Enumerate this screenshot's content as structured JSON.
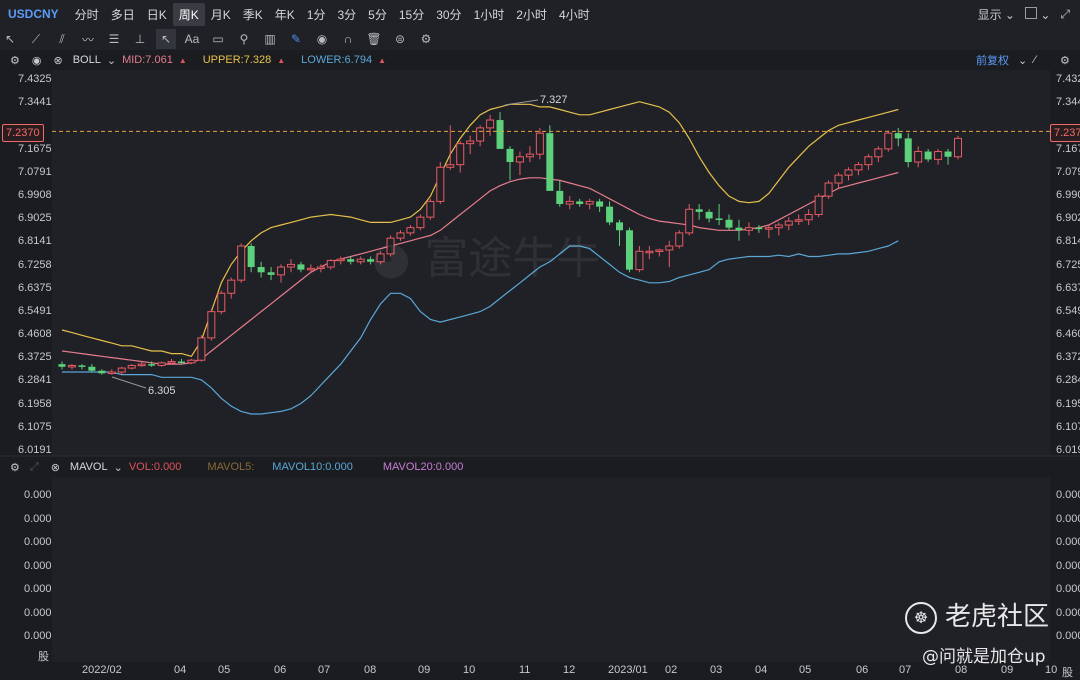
{
  "header": {
    "symbol": "USDCNY",
    "periods": [
      "分时",
      "多日",
      "日K",
      "周K",
      "月K",
      "季K",
      "年K",
      "1分",
      "3分",
      "5分",
      "15分",
      "30分",
      "1小时",
      "2小时",
      "4小时"
    ],
    "active_period": "周K",
    "display_label": "显示",
    "adjust_label": "前复权"
  },
  "toolbar": {
    "icons": [
      "cursor-icon",
      "line-icon",
      "channel-icon",
      "wave-icon",
      "fib-icon",
      "pitchfork-icon",
      "arrow-icon",
      "text-icon",
      "note-icon",
      "search-icon",
      "measure-icon",
      "pen-icon",
      "eye-icon",
      "magnet-icon",
      "trash-icon",
      "layers-icon",
      "gear-icon"
    ],
    "text_tool_label": "Aa"
  },
  "boll": {
    "name": "BOLL",
    "mid": "MID:7.061",
    "upper": "UPPER:7.328",
    "lower": "LOWER:6.794",
    "mid_color": "#e77c8e",
    "upper_color": "#e6c14a",
    "lower_color": "#5aa7d8"
  },
  "price_axis": {
    "ticks": [
      "7.4325",
      "7.3441",
      "7.2370",
      "7.1675",
      "7.0791",
      "6.9908",
      "6.9025",
      "6.8141",
      "6.7258",
      "6.6375",
      "6.5491",
      "6.4608",
      "6.3725",
      "6.2841",
      "6.1958",
      "6.1075",
      "6.0191"
    ],
    "current": "7.2370",
    "right_current": "7.237"
  },
  "annotations": {
    "high": "7.327",
    "low": "6.305"
  },
  "volume": {
    "name": "MAVOL",
    "vol": "VOL:0.000",
    "mavol5": "MAVOL5:",
    "mavol10": "MAVOL10:0.000",
    "mavol20": "MAVOL20:0.000",
    "ticks": [
      "0.000",
      "0.000",
      "0.000",
      "0.000",
      "0.000",
      "0.000",
      "0.000"
    ],
    "unit": "股"
  },
  "x_axis": {
    "labels": [
      "2022/02",
      "04",
      "05",
      "06",
      "07",
      "08",
      "09",
      "10",
      "11",
      "12",
      "2023/01",
      "02",
      "03",
      "04",
      "05",
      "06",
      "07",
      "08",
      "09",
      "10"
    ]
  },
  "watermark": {
    "center": "富途牛牛",
    "brand": "老虎社区",
    "user": "@问就是加仓up"
  },
  "chart_data": {
    "type": "candlestick",
    "title": "USDCNY",
    "ylim": [
      6.0191,
      7.4325
    ],
    "candles": [
      [
        6.35,
        6.36,
        6.33,
        6.34
      ],
      [
        6.34,
        6.35,
        6.33,
        6.345
      ],
      [
        6.345,
        6.35,
        6.33,
        6.34
      ],
      [
        6.34,
        6.35,
        6.32,
        6.325
      ],
      [
        6.325,
        6.33,
        6.31,
        6.315
      ],
      [
        6.315,
        6.33,
        6.31,
        6.32
      ],
      [
        6.32,
        6.34,
        6.31,
        6.335
      ],
      [
        6.335,
        6.35,
        6.33,
        6.345
      ],
      [
        6.345,
        6.36,
        6.34,
        6.35
      ],
      [
        6.35,
        6.36,
        6.34,
        6.345
      ],
      [
        6.345,
        6.36,
        6.34,
        6.355
      ],
      [
        6.355,
        6.37,
        6.35,
        6.36
      ],
      [
        6.36,
        6.37,
        6.35,
        6.355
      ],
      [
        6.355,
        6.37,
        6.35,
        6.365
      ],
      [
        6.365,
        6.46,
        6.36,
        6.45
      ],
      [
        6.45,
        6.56,
        6.44,
        6.55
      ],
      [
        6.55,
        6.63,
        6.54,
        6.62
      ],
      [
        6.62,
        6.68,
        6.6,
        6.67
      ],
      [
        6.67,
        6.81,
        6.66,
        6.8
      ],
      [
        6.8,
        6.81,
        6.7,
        6.72
      ],
      [
        6.72,
        6.74,
        6.68,
        6.7
      ],
      [
        6.7,
        6.72,
        6.67,
        6.69
      ],
      [
        6.69,
        6.73,
        6.66,
        6.72
      ],
      [
        6.72,
        6.75,
        6.7,
        6.73
      ],
      [
        6.73,
        6.74,
        6.7,
        6.71
      ],
      [
        6.71,
        6.73,
        6.7,
        6.715
      ],
      [
        6.715,
        6.73,
        6.7,
        6.72
      ],
      [
        6.72,
        6.75,
        6.71,
        6.745
      ],
      [
        6.745,
        6.76,
        6.73,
        6.75
      ],
      [
        6.75,
        6.76,
        6.73,
        6.74
      ],
      [
        6.74,
        6.76,
        6.73,
        6.75
      ],
      [
        6.75,
        6.76,
        6.73,
        6.74
      ],
      [
        6.74,
        6.78,
        6.73,
        6.77
      ],
      [
        6.77,
        6.84,
        6.76,
        6.83
      ],
      [
        6.83,
        6.86,
        6.82,
        6.85
      ],
      [
        6.85,
        6.88,
        6.84,
        6.87
      ],
      [
        6.87,
        6.92,
        6.86,
        6.91
      ],
      [
        6.91,
        6.98,
        6.9,
        6.97
      ],
      [
        6.97,
        7.12,
        6.96,
        7.1
      ],
      [
        7.1,
        7.26,
        7.09,
        7.11
      ],
      [
        7.11,
        7.2,
        7.08,
        7.19
      ],
      [
        7.19,
        7.22,
        7.15,
        7.2
      ],
      [
        7.2,
        7.26,
        7.18,
        7.25
      ],
      [
        7.25,
        7.3,
        7.22,
        7.28
      ],
      [
        7.28,
        7.31,
        7.25,
        7.17
      ],
      [
        7.17,
        7.18,
        7.05,
        7.12
      ],
      [
        7.12,
        7.16,
        7.07,
        7.14
      ],
      [
        7.14,
        7.18,
        7.12,
        7.15
      ],
      [
        7.15,
        7.25,
        7.13,
        7.23
      ],
      [
        7.23,
        7.26,
        7.02,
        7.01
      ],
      [
        7.01,
        7.05,
        6.95,
        6.96
      ],
      [
        6.96,
        6.99,
        6.94,
        6.97
      ],
      [
        6.97,
        6.98,
        6.95,
        6.96
      ],
      [
        6.96,
        6.98,
        6.94,
        6.97
      ],
      [
        6.97,
        6.98,
        6.93,
        6.95
      ],
      [
        6.95,
        6.97,
        6.88,
        6.89
      ],
      [
        6.89,
        6.9,
        6.8,
        6.86
      ],
      [
        6.86,
        6.87,
        6.7,
        6.71
      ],
      [
        6.71,
        6.8,
        6.7,
        6.78
      ],
      [
        6.78,
        6.8,
        6.75,
        6.78
      ],
      [
        6.78,
        6.79,
        6.76,
        6.785
      ],
      [
        6.785,
        6.82,
        6.72,
        6.8
      ],
      [
        6.8,
        6.86,
        6.79,
        6.85
      ],
      [
        6.85,
        6.96,
        6.84,
        6.94
      ],
      [
        6.94,
        6.96,
        6.9,
        6.93
      ],
      [
        6.93,
        6.94,
        6.89,
        6.905
      ],
      [
        6.905,
        6.96,
        6.88,
        6.9
      ],
      [
        6.9,
        6.92,
        6.86,
        6.87
      ],
      [
        6.87,
        6.9,
        6.82,
        6.86
      ],
      [
        6.86,
        6.89,
        6.84,
        6.87
      ],
      [
        6.87,
        6.88,
        6.85,
        6.865
      ],
      [
        6.865,
        6.88,
        6.83,
        6.87
      ],
      [
        6.87,
        6.89,
        6.84,
        6.88
      ],
      [
        6.88,
        6.91,
        6.86,
        6.895
      ],
      [
        6.895,
        6.92,
        6.88,
        6.9
      ],
      [
        6.9,
        6.94,
        6.88,
        6.92
      ],
      [
        6.92,
        7.0,
        6.91,
        6.99
      ],
      [
        6.99,
        7.05,
        6.98,
        7.04
      ],
      [
        7.04,
        7.08,
        7.02,
        7.07
      ],
      [
        7.07,
        7.1,
        7.05,
        7.09
      ],
      [
        7.09,
        7.12,
        7.07,
        7.11
      ],
      [
        7.11,
        7.15,
        7.09,
        7.14
      ],
      [
        7.14,
        7.18,
        7.12,
        7.17
      ],
      [
        7.17,
        7.24,
        7.16,
        7.23
      ],
      [
        7.23,
        7.25,
        7.18,
        7.21
      ],
      [
        7.21,
        7.23,
        7.1,
        7.12
      ],
      [
        7.12,
        7.18,
        7.1,
        7.16
      ],
      [
        7.16,
        7.17,
        7.12,
        7.13
      ],
      [
        7.13,
        7.17,
        7.11,
        7.16
      ],
      [
        7.16,
        7.17,
        7.11,
        7.14
      ],
      [
        7.14,
        7.22,
        7.13,
        7.21
      ]
    ],
    "upper": [
      6.48,
      6.47,
      6.46,
      6.45,
      6.44,
      6.43,
      6.42,
      6.42,
      6.41,
      6.4,
      6.4,
      6.39,
      6.39,
      6.38,
      6.44,
      6.55,
      6.66,
      6.73,
      6.78,
      6.82,
      6.85,
      6.87,
      6.88,
      6.89,
      6.9,
      6.91,
      6.915,
      6.92,
      6.915,
      6.91,
      6.9,
      6.89,
      6.89,
      6.89,
      6.9,
      6.91,
      6.94,
      6.99,
      7.07,
      7.15,
      7.21,
      7.26,
      7.3,
      7.32,
      7.33,
      7.34,
      7.34,
      7.34,
      7.33,
      7.33,
      7.32,
      7.31,
      7.3,
      7.3,
      7.31,
      7.32,
      7.33,
      7.34,
      7.35,
      7.34,
      7.33,
      7.31,
      7.27,
      7.21,
      7.14,
      7.08,
      7.03,
      6.99,
      6.97,
      6.965,
      6.97,
      7.0,
      7.05,
      7.1,
      7.14,
      7.18,
      7.21,
      7.24,
      7.26,
      7.27,
      7.28,
      7.29,
      7.3,
      7.31,
      7.32
    ],
    "mid": [
      6.4,
      6.395,
      6.39,
      6.385,
      6.38,
      6.375,
      6.37,
      6.365,
      6.36,
      6.355,
      6.35,
      6.35,
      6.35,
      6.355,
      6.37,
      6.4,
      6.43,
      6.46,
      6.49,
      6.52,
      6.55,
      6.58,
      6.61,
      6.64,
      6.67,
      6.7,
      6.72,
      6.74,
      6.75,
      6.76,
      6.77,
      6.78,
      6.79,
      6.8,
      6.81,
      6.82,
      6.83,
      6.84,
      6.86,
      6.89,
      6.92,
      6.95,
      6.98,
      7.01,
      7.03,
      7.045,
      7.055,
      7.06,
      7.06,
      7.055,
      7.05,
      7.04,
      7.03,
      7.02,
      7.0,
      6.98,
      6.96,
      6.94,
      6.92,
      6.905,
      6.895,
      6.89,
      6.885,
      6.88,
      6.87,
      6.865,
      6.86,
      6.86,
      6.86,
      6.865,
      6.87,
      6.88,
      6.9,
      6.92,
      6.94,
      6.96,
      6.98,
      7.0,
      7.02,
      7.03,
      7.04,
      7.05,
      7.06,
      7.07,
      7.08
    ],
    "lower": [
      6.32,
      6.32,
      6.32,
      6.32,
      6.32,
      6.32,
      6.31,
      6.31,
      6.31,
      6.31,
      6.3,
      6.3,
      6.3,
      6.3,
      6.29,
      6.26,
      6.22,
      6.19,
      6.17,
      6.16,
      6.16,
      6.165,
      6.17,
      6.18,
      6.2,
      6.23,
      6.27,
      6.31,
      6.35,
      6.4,
      6.45,
      6.52,
      6.58,
      6.62,
      6.62,
      6.6,
      6.55,
      6.52,
      6.51,
      6.52,
      6.53,
      6.54,
      6.55,
      6.57,
      6.6,
      6.63,
      6.66,
      6.69,
      6.72,
      6.74,
      6.77,
      6.8,
      6.8,
      6.79,
      6.76,
      6.73,
      6.7,
      6.68,
      6.67,
      6.66,
      6.66,
      6.665,
      6.68,
      6.69,
      6.7,
      6.71,
      6.74,
      6.75,
      6.755,
      6.76,
      6.76,
      6.76,
      6.765,
      6.76,
      6.77,
      6.76,
      6.76,
      6.765,
      6.77,
      6.77,
      6.775,
      6.78,
      6.79,
      6.8,
      6.82
    ]
  }
}
